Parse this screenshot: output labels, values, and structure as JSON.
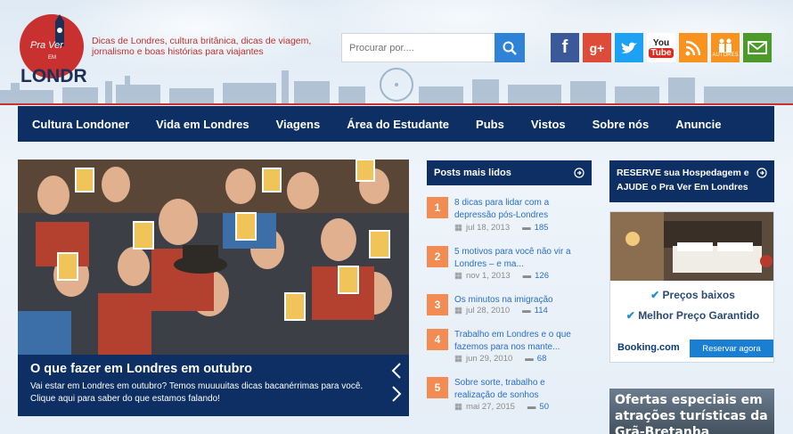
{
  "header": {
    "logo_top": "Pra Ver",
    "logo_small": "EM",
    "logo_main": "LONDRES",
    "tagline": "Dicas de Londres, cultura britânica, dicas de viagem, jornalismo e boas histórias para viajantes",
    "search_placeholder": "Procurar por....",
    "social": [
      {
        "name": "facebook",
        "label": "f",
        "color": "#3b5998"
      },
      {
        "name": "google-plus",
        "label": "g+",
        "color": "#dd4b39"
      },
      {
        "name": "twitter",
        "label": "t",
        "color": "#1da1f2"
      },
      {
        "name": "youtube",
        "label": "YouTube",
        "color": "#ffffff"
      },
      {
        "name": "rss",
        "label": "rss",
        "color": "#f7931e"
      },
      {
        "name": "autores",
        "label": "AUTORES",
        "color": "#f7931e"
      },
      {
        "name": "email",
        "label": "mail",
        "color": "#4c9a2a"
      }
    ]
  },
  "nav": [
    "Cultura Londoner",
    "Vida em Londres",
    "Viagens",
    "Área do Estudante",
    "Pubs",
    "Vistos",
    "Sobre nós",
    "Anuncie"
  ],
  "slider": {
    "title": "O que fazer em Londres em outubro",
    "text": "Vai estar em Londres em outubro? Temos muuuuitas dicas bacanérrimas para você. Clique aqui para saber do que estamos falando!"
  },
  "popular": {
    "heading": "Posts mais lidos",
    "posts": [
      {
        "num": "1",
        "title": "8 dicas para lidar com a depressão pós-Londres",
        "date": "jul 18, 2013",
        "comments": "185"
      },
      {
        "num": "2",
        "title": "5 motivos para você não vir a Londres – e ma...",
        "date": "nov 1, 2013",
        "comments": "126"
      },
      {
        "num": "3",
        "title": "Os minutos na imigração",
        "date": "jul 28, 2010",
        "comments": "114"
      },
      {
        "num": "4",
        "title": "Trabalho em Londres e o que fazemos para nos mante...",
        "date": "jun 29, 2010",
        "comments": "68"
      },
      {
        "num": "5",
        "title": "Sobre sorte, trabalho e realização de sonhos",
        "date": "mai 27, 2015",
        "comments": "50"
      }
    ]
  },
  "sidebar": {
    "reserve": "RESERVE sua Hospedagem e AJUDE o Pra Ver Em Londres",
    "booking_feature_1": "Preços baixos",
    "booking_feature_2": "Melhor Preço Garantido",
    "booking_brand": "Booking.com",
    "booking_button": "Reservar agora",
    "offers": "Ofertas especiais em atrações turísticas da Grã-Bretanha"
  },
  "colors": {
    "navy": "#0d2f63",
    "orange": "#f28c52",
    "link": "#2b6fc4",
    "red": "#c0302c"
  }
}
